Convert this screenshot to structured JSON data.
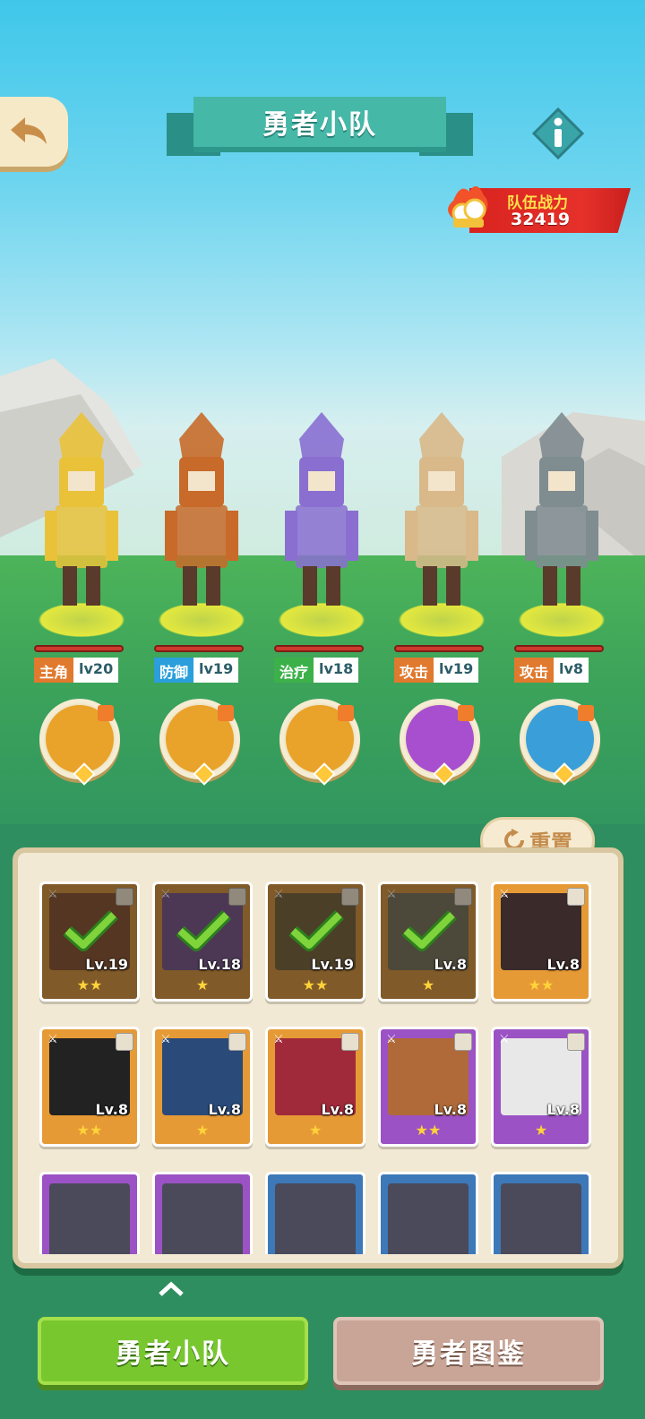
{
  "header": {
    "title": "勇者小队",
    "back_icon": "back-arrow-icon",
    "info_icon": "info-icon"
  },
  "team_power": {
    "label": "队伍战力",
    "value": "32419"
  },
  "heroes": [
    {
      "role": "主角",
      "level": "lv20",
      "role_color": "#e07a2e"
    },
    {
      "role": "防御",
      "level": "lv19",
      "role_color": "#2a9fdc"
    },
    {
      "role": "治疗",
      "level": "lv18",
      "role_color": "#3cb14a"
    },
    {
      "role": "攻击",
      "level": "lv19",
      "role_color": "#e07a2e"
    },
    {
      "role": "攻击",
      "level": "lv8",
      "role_color": "#e07a2e"
    }
  ],
  "panel": {
    "reset_label": "重置",
    "cards": [
      {
        "level": "Lv.19",
        "stars": "★★",
        "selected": true
      },
      {
        "level": "Lv.18",
        "stars": "★",
        "selected": true
      },
      {
        "level": "Lv.19",
        "stars": "★★",
        "selected": true
      },
      {
        "level": "Lv.8",
        "stars": "★",
        "selected": true
      },
      {
        "level": "Lv.8",
        "stars": "★★",
        "selected": false
      },
      {
        "level": "Lv.8",
        "stars": "★★",
        "selected": false
      },
      {
        "level": "Lv.8",
        "stars": "★",
        "selected": false
      },
      {
        "level": "Lv.8",
        "stars": "★",
        "selected": false
      },
      {
        "level": "Lv.8",
        "stars": "★★",
        "selected": false
      },
      {
        "level": "Lv.8",
        "stars": "★",
        "selected": false
      }
    ]
  },
  "tabs": {
    "team": "勇者小队",
    "codex": "勇者图鉴"
  }
}
